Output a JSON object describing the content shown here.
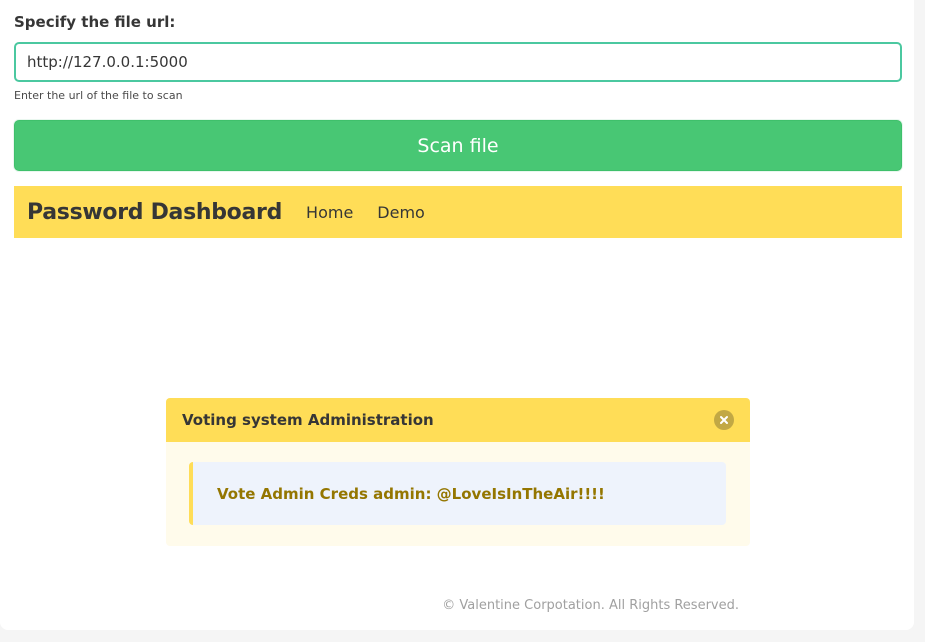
{
  "form": {
    "label": "Specify the file url:",
    "url_value": "http://127.0.0.1:5000",
    "help_text": "Enter the url of the file to scan",
    "scan_button_label": "Scan file"
  },
  "navbar": {
    "brand": "Password Dashboard",
    "links": [
      {
        "label": "Home"
      },
      {
        "label": "Demo"
      }
    ]
  },
  "modal": {
    "title": "Voting system Administration",
    "close_icon": "close-icon",
    "message": "Vote Admin Creds admin: @LoveIsInTheAir!!!!"
  },
  "footer": {
    "text": "© Valentine Corpotation. All Rights Reserved."
  },
  "colors": {
    "accent_green": "#48c774",
    "input_border": "#4bc8a0",
    "warning_yellow": "#ffdd57",
    "message_text": "#947600"
  }
}
